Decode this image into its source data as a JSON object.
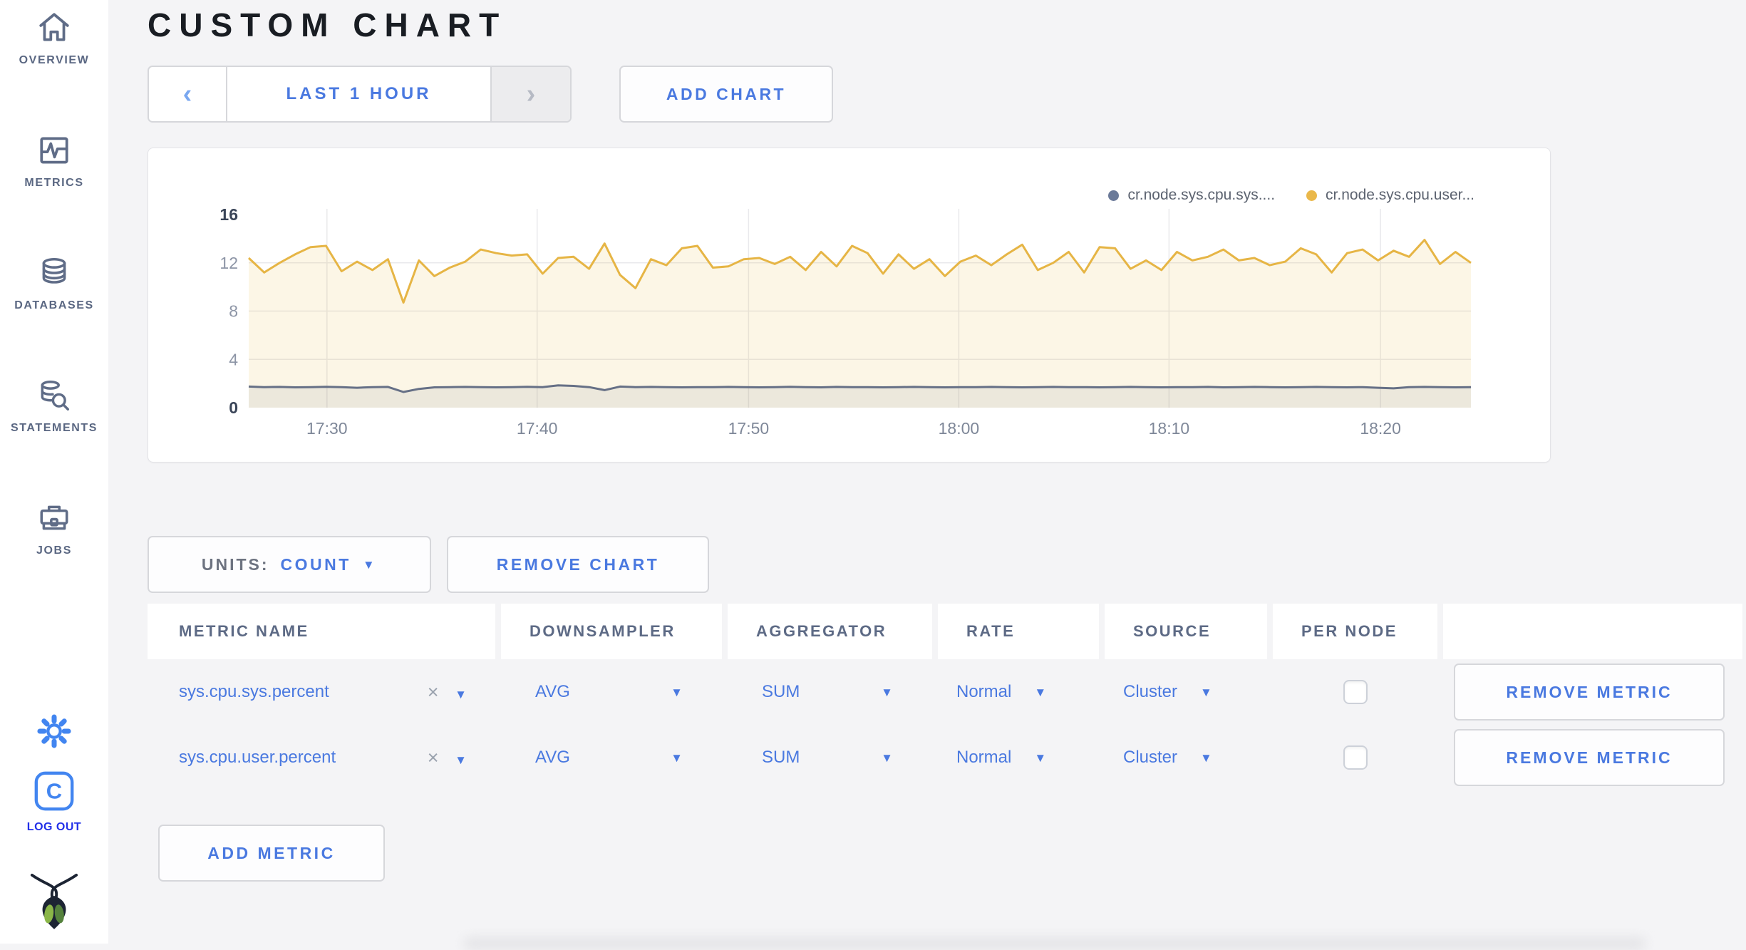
{
  "header": {
    "title": "CUSTOM CHART"
  },
  "icons": {
    "chevron_left": "‹",
    "chevron_right": "›",
    "caret_down": "▼",
    "clear": "×"
  },
  "colors": {
    "accent_blue": "#4a79e0",
    "logout_blue": "#2230e8",
    "icon_blue": "#4285f0",
    "sidebar_slate": "#5f6c87"
  },
  "sidebar": {
    "items": [
      {
        "label": "OVERVIEW",
        "icon": "home-icon"
      },
      {
        "label": "METRICS",
        "icon": "metrics-icon"
      },
      {
        "label": "DATABASES",
        "icon": "database-icon"
      },
      {
        "label": "STATEMENTS",
        "icon": "statements-icon"
      },
      {
        "label": "JOBS",
        "icon": "briefcase-icon"
      }
    ],
    "logout_label": "LOG OUT"
  },
  "toolbar": {
    "time_range_label": "LAST 1 HOUR",
    "add_chart_label": "ADD CHART"
  },
  "chart_controls": {
    "units_label": "UNITS:",
    "units_value": "COUNT",
    "remove_chart_label": "REMOVE CHART",
    "add_metric_label": "ADD METRIC"
  },
  "table": {
    "headers": [
      "METRIC NAME",
      "DOWNSAMPLER",
      "AGGREGATOR",
      "RATE",
      "SOURCE",
      "PER NODE"
    ],
    "rows": [
      {
        "metric": "sys.cpu.sys.percent",
        "downsampler": "AVG",
        "aggregator": "SUM",
        "rate": "Normal",
        "source": "Cluster",
        "per_node": false,
        "remove_label": "REMOVE METRIC"
      },
      {
        "metric": "sys.cpu.user.percent",
        "downsampler": "AVG",
        "aggregator": "SUM",
        "rate": "Normal",
        "source": "Cluster",
        "per_node": false,
        "remove_label": "REMOVE METRIC"
      }
    ]
  },
  "chart_data": {
    "type": "area",
    "title": "",
    "xlabel": "",
    "ylabel": "",
    "ylim": [
      0,
      16
    ],
    "grid": true,
    "legend_position": "top-right",
    "x_ticks": [
      "17:30",
      "17:40",
      "17:50",
      "18:00",
      "18:10",
      "18:20"
    ],
    "x_tick_fracs": [
      0.064,
      0.236,
      0.409,
      0.581,
      0.753,
      0.926
    ],
    "grid_y": [
      4,
      8,
      12
    ],
    "y_ticks": [
      {
        "v": 16,
        "label": "16",
        "strong": true
      },
      {
        "v": 12,
        "label": "12",
        "strong": false
      },
      {
        "v": 8,
        "label": "8",
        "strong": false
      },
      {
        "v": 4,
        "label": "4",
        "strong": false
      },
      {
        "v": 0,
        "label": "0",
        "strong": true
      }
    ],
    "legend": [
      {
        "name": "cr.node.sys.cpu.sys....",
        "color": "#6b7a99"
      },
      {
        "name": "cr.node.sys.cpu.user...",
        "color": "#eab84a"
      }
    ],
    "series": [
      {
        "name": "cr.node.sys.cpu.user...",
        "color": "#e6b545",
        "fill": "rgba(231,182,62,0.13)",
        "values": [
          12.4,
          11.2,
          12.0,
          12.7,
          13.3,
          13.4,
          11.3,
          12.1,
          11.4,
          12.3,
          8.7,
          12.2,
          10.9,
          11.6,
          12.1,
          13.1,
          12.8,
          12.6,
          12.7,
          11.1,
          12.4,
          12.5,
          11.5,
          13.6,
          11.0,
          9.9,
          12.3,
          11.8,
          13.2,
          13.4,
          11.6,
          11.7,
          12.3,
          12.4,
          11.9,
          12.5,
          11.4,
          12.9,
          11.7,
          13.4,
          12.8,
          11.1,
          12.7,
          11.5,
          12.3,
          10.9,
          12.1,
          12.6,
          11.8,
          12.7,
          13.5,
          11.4,
          12.0,
          12.9,
          11.2,
          13.3,
          13.2,
          11.5,
          12.2,
          11.4,
          12.9,
          12.2,
          12.5,
          13.1,
          12.2,
          12.4,
          11.8,
          12.1,
          13.2,
          12.7,
          11.2,
          12.8,
          13.1,
          12.2,
          13.0,
          12.5,
          13.9,
          11.9,
          12.9,
          12.0
        ]
      },
      {
        "name": "cr.node.sys.cpu.sys....",
        "color": "#667086",
        "fill": "rgba(102,112,134,0.10)",
        "values": [
          1.75,
          1.7,
          1.72,
          1.68,
          1.7,
          1.73,
          1.7,
          1.65,
          1.7,
          1.72,
          1.3,
          1.55,
          1.68,
          1.7,
          1.72,
          1.7,
          1.68,
          1.7,
          1.73,
          1.7,
          1.85,
          1.8,
          1.7,
          1.45,
          1.75,
          1.7,
          1.72,
          1.7,
          1.68,
          1.7,
          1.7,
          1.72,
          1.7,
          1.68,
          1.7,
          1.73,
          1.7,
          1.68,
          1.72,
          1.7,
          1.7,
          1.68,
          1.7,
          1.72,
          1.7,
          1.68,
          1.7,
          1.7,
          1.72,
          1.7,
          1.68,
          1.7,
          1.72,
          1.7,
          1.7,
          1.68,
          1.7,
          1.72,
          1.7,
          1.68,
          1.7,
          1.7,
          1.72,
          1.68,
          1.7,
          1.72,
          1.7,
          1.68,
          1.7,
          1.72,
          1.7,
          1.68,
          1.7,
          1.65,
          1.6,
          1.7,
          1.72,
          1.7,
          1.68,
          1.7
        ]
      }
    ]
  }
}
